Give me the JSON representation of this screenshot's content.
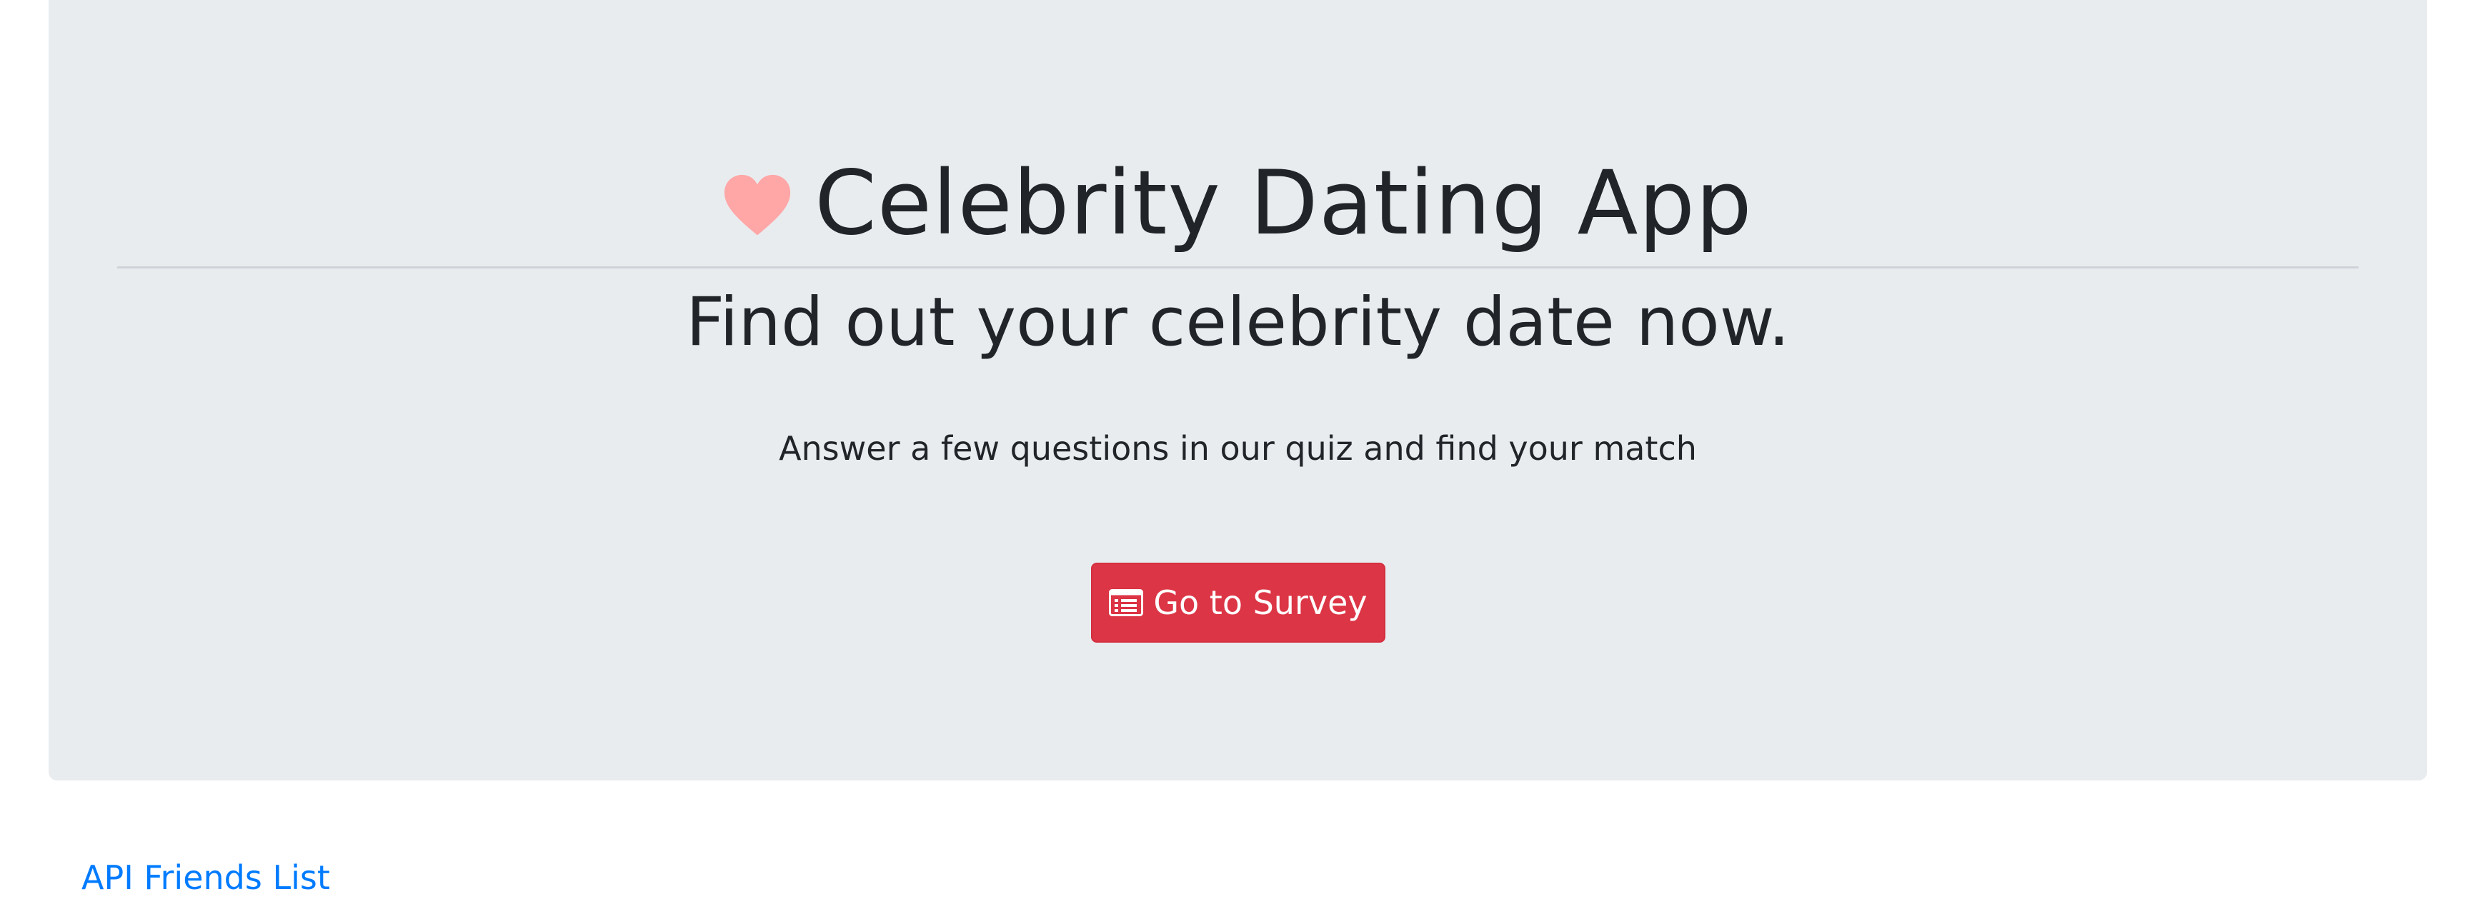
{
  "header": {
    "title": "Celebrity Dating App",
    "icon": "heart-icon",
    "icon_color": "#ffa6a6"
  },
  "hero": {
    "heading": "Find out your celebrity date now.",
    "subtext": "Answer a few questions in our quiz and find your match",
    "button": {
      "label": "Go to Survey",
      "icon": "list-alt-icon",
      "color": "#dc3545"
    },
    "background": "#e9ecef"
  },
  "footer": {
    "link_label": "API Friends List",
    "link_color": "#007bff"
  }
}
